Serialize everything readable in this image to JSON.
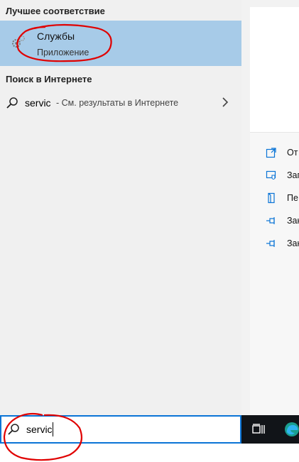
{
  "best_match": {
    "header": "Лучшее соответствие",
    "app_title": "Службы",
    "app_subtitle": "Приложение"
  },
  "web": {
    "header": "Поиск в Интернете",
    "query": "servic",
    "hint": "- См. результаты в Интернете"
  },
  "right_panel": {
    "actions": [
      {
        "label": "От",
        "icon": "open-icon"
      },
      {
        "label": "Зап",
        "icon": "run-as-admin-icon"
      },
      {
        "label": "Пе",
        "icon": "file-location-icon"
      },
      {
        "label": "Зак",
        "icon": "pin-icon"
      },
      {
        "label": "Зак",
        "icon": "pin-icon"
      }
    ]
  },
  "search": {
    "value": "servic"
  },
  "colors": {
    "selection": "#a7cbe8",
    "accent": "#0a74d6",
    "annotation": "#e00000",
    "taskbar": "#111418"
  }
}
